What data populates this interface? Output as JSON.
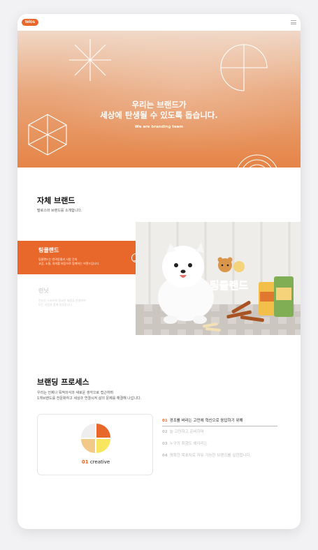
{
  "header": {
    "logo_text": "telos",
    "menu_icon": "hamburger-icon"
  },
  "hero": {
    "title_line1": "우리는 브랜드가",
    "title_line2": "세상에 탄생될 수 있도록 돕습니다.",
    "subtitle": "We are branding team"
  },
  "own_brand": {
    "title": "자체 브랜드",
    "description": "텔로스의 브랜드를 소개합니다."
  },
  "brands": [
    {
      "name": "팅클랜드",
      "desc_line1": "팅클랜드는 반려동물과 사람 간의",
      "desc_line2": "교감, 소통, 의미를 바탕으로 함께하는 브랜드입니다.",
      "active": true
    },
    {
      "name": "런닛",
      "desc_line1": "런닛은 스포츠에 필요한 제품을 연결하여",
      "desc_line2": "모든 지원과 함께 성장합니다.",
      "active": false
    }
  ],
  "product_label": "팅클랜드",
  "process": {
    "title": "브랜딩 프로세스",
    "desc_line1": "우리는 언제나 목적의식과 새로운 생각으로 접근하며",
    "desc_line2": "1개브랜드를 전문화하고 세상과 연결시켜 삶의 문제를 해결해 나갑니다.",
    "card_label_num": "01",
    "card_label_text": "creative",
    "steps": [
      {
        "num": "01",
        "text": "경조를 바라는 고민에 혁신으로 응답하기 위해",
        "active": true
      },
      {
        "num": "02",
        "text": "늘 고민하고 준비하며",
        "active": false
      },
      {
        "num": "03",
        "text": "누구의 취향도 헤아리는",
        "active": false
      },
      {
        "num": "04",
        "text": "명확한 목표치로 자유 가능한 브랜드를 실현합니다.",
        "active": false
      }
    ]
  },
  "colors": {
    "accent": "#e8672a",
    "background": "#f2f2f4"
  }
}
